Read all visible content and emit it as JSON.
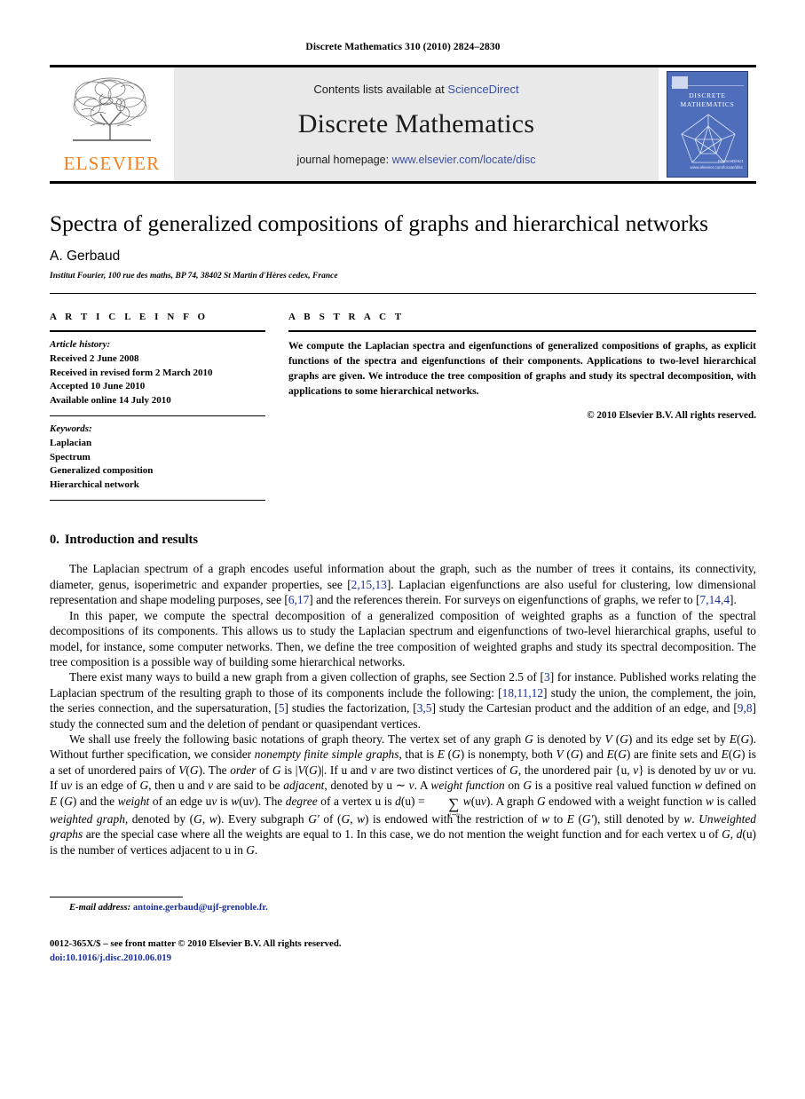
{
  "running_head": "Discrete Mathematics 310 (2010) 2824–2830",
  "masthead": {
    "contents_prefix": "Contents lists available at ",
    "sciencedirect": "ScienceDirect",
    "journal_name": "Discrete Mathematics",
    "homepage_prefix": "journal homepage: ",
    "homepage_url": "www.elsevier.com/locate/disc",
    "publisher_logo_text": "ELSEVIER",
    "cover_title_line1": "DISCRETE",
    "cover_title_line2": "MATHEMATICS",
    "cover_sciencedirect": "ScienceDirect",
    "cover_sciencedirect_sub": "www.elsevier.com/locate/disc",
    "accent_orange": "#f08020",
    "link_blue": "#3b50a0",
    "cover_blue": "#4e6dbb",
    "band_gray": "#e9e9e9"
  },
  "article": {
    "title": "Spectra of generalized compositions of graphs and hierarchical networks",
    "authors": "A. Gerbaud",
    "affiliation": "Institut Fourier, 100 rue des maths, BP 74, 38402 St Martin d'Hères cedex, France"
  },
  "info": {
    "label": "A R T I C L E    I N F O",
    "history_label": "Article history:",
    "history": [
      "Received 2 June 2008",
      "Received in revised form 2 March 2010",
      "Accepted 10 June 2010",
      "Available online 14 July 2010"
    ],
    "keywords_label": "Keywords:",
    "keywords": [
      "Laplacian",
      "Spectrum",
      "Generalized composition",
      "Hierarchical network"
    ]
  },
  "abstract": {
    "label": "A B S T R A C T",
    "text": "We compute the Laplacian spectra and eigenfunctions of generalized compositions of graphs, as explicit functions of the spectra and eigenfunctions of their components. Applications to two-level hierarchical graphs are given. We introduce the tree composition of graphs and study its spectral decomposition, with applications to some hierarchical networks.",
    "copyright": "© 2010 Elsevier B.V. All rights reserved."
  },
  "body": {
    "section_number": "0.",
    "section_title": "Introduction and results",
    "paragraph1": {
      "a": "The Laplacian spectrum of a graph encodes useful information about the graph, such as the number of trees it contains, its connectivity, diameter, genus, isoperimetric and expander properties, see [",
      "cite1": "2,15,13",
      "b": "]. Laplacian eigenfunctions are also useful for clustering, low dimensional representation and shape modeling purposes, see [",
      "cite2": "6,17",
      "c": "] and the references therein. For surveys on eigenfunctions of graphs, we refer to [",
      "cite3": "7,14,4",
      "d": "]."
    },
    "paragraph2": "In this paper, we compute the spectral decomposition of a generalized composition of weighted graphs as a function of the spectral decompositions of its components. This allows us to study the Laplacian spectrum and eigenfunctions of two-level hierarchical graphs, useful to model, for instance, some computer networks. Then, we define the tree composition of weighted graphs and study its spectral decomposition. The tree composition is a possible way of building some hierarchical networks.",
    "paragraph3": {
      "a": "There exist many ways to build a new graph from a given collection of graphs, see Section 2.5 of [",
      "cite1": "3",
      "b": "] for instance. Published works relating the Laplacian spectrum of the resulting graph to those of its components include the following: [",
      "cite2": "18,11,12",
      "c": "] study the union, the complement, the join, the series connection, and the supersaturation, [",
      "cite3": "5",
      "d": "] studies the factorization, [",
      "cite4": "3,5",
      "e": "] study the Cartesian product and the addition of an edge, and [",
      "cite5": "9,8",
      "f": "] study the connected sum and the deletion of pendant or quasipendant vertices."
    },
    "paragraph4": {
      "p1": "We shall use freely the following basic notations of graph theory. The vertex set of any graph ",
      "g1": "G",
      "p2": " is denoted by ",
      "vg1": "V",
      "p3": " (",
      "g2": "G",
      "p4": ") and its edge set by ",
      "eg1": "E",
      "p5": "(",
      "g3": "G",
      "p6": "). Without further specification, we consider ",
      "em1": "nonempty finite simple graphs",
      "p7": ", that is ",
      "eg2": "E",
      "p8": " (",
      "g4": "G",
      "p9": ") is nonempty, both ",
      "vg2": "V",
      "p10": " (",
      "g5": "G",
      "p11": ") and ",
      "eg3": "E",
      "p12": "(",
      "g6": "G",
      "p13": ") are finite sets and ",
      "eg4": "E",
      "p14": "(",
      "g7": "G",
      "p15": ") is a set of unordered pairs of ",
      "vg3": "V",
      "p16": "(",
      "g8": "G",
      "p17": "). The ",
      "em2": "order",
      "p18": " of ",
      "g9": "G",
      "p19": " is |",
      "vg4": "V",
      "p20": "(",
      "g10": "G",
      "p21": ")|. If u and ",
      "v1": "v",
      "p22": " are two distinct vertices of ",
      "g11": "G",
      "p23": ", the unordered pair {u, ",
      "v2": "v",
      "p24": "} is denoted by u",
      "v3": "v",
      "p25": " or ",
      "v4": "v",
      "p26": "u. If u",
      "v5": "v",
      "p27": " is an edge of ",
      "g12": "G",
      "p28": ", then u and ",
      "v6": "v",
      "p29": " are said to be ",
      "em3": "adjacent",
      "p30": ", denoted by u ∼ ",
      "v7": "v",
      "p31": ". A ",
      "em4": "weight function",
      "p32": " on ",
      "g13": "G",
      "p33": " is a positive real valued function ",
      "w1": "w",
      "p34": " defined on ",
      "eg5": "E",
      "p35": " (",
      "g14": "G",
      "p36": ") and the ",
      "em5": "weight",
      "p37": " of an edge u",
      "v8": "v",
      "p38": " is ",
      "w2": "w",
      "p39": "(u",
      "v9": "v",
      "p40": "). The ",
      "em6": "degree",
      "p41": " of a vertex u is ",
      "d1": "d",
      "p42": "(u) = ",
      "sum_sign": "∑",
      "sum_sub": "v∼u",
      "p43": " ",
      "w3": "w",
      "p44": "(u",
      "v10": "v",
      "p45": "). A graph ",
      "g15": "G",
      "p46": " endowed with a weight function ",
      "w4": "w",
      "p47": " is called ",
      "em7": "weighted graph",
      "p48": ", denoted by (",
      "g16": "G",
      "p49": ", ",
      "w5": "w",
      "p50": "). Every subgraph ",
      "g17": "G′",
      "p51": " of (",
      "g18": "G",
      "p52": ", ",
      "w6": "w",
      "p53": ") is endowed with the restriction of ",
      "w7": "w",
      "p54": " to ",
      "eg6": "E",
      "p55": " (",
      "g19": "G′",
      "p56": "), still denoted by ",
      "w8": "w",
      "p57": ". ",
      "em8": "Unweighted graphs",
      "p58": " are the special case where all the weights are equal to 1. In this case, we do not mention the weight function and for each vertex u of ",
      "g20": "G",
      "p59": ", ",
      "d2": "d",
      "p60": "(u) is the number of vertices adjacent to u in ",
      "g21": "G",
      "p61": "."
    }
  },
  "footnote": {
    "email_label": "E-mail address:",
    "email": "antoine.gerbaud@ujf-grenoble.fr."
  },
  "footer": {
    "front_matter": "0012-365X/$ – see front matter © 2010 Elsevier B.V. All rights reserved.",
    "doi": "doi:10.1016/j.disc.2010.06.019"
  }
}
